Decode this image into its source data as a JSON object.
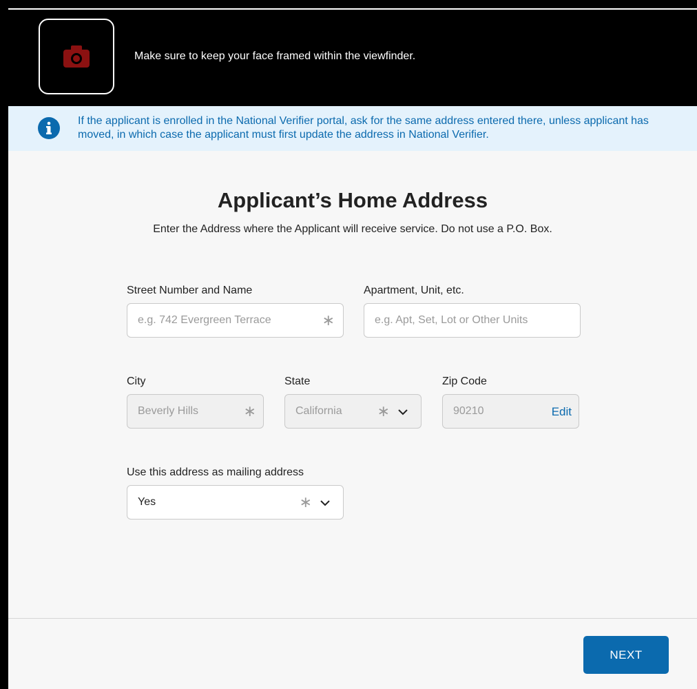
{
  "camera": {
    "message": "Make sure to keep your face framed within the viewfinder.",
    "icon": "camera-icon",
    "icon_color": "#8b1111"
  },
  "banner": {
    "icon": "info-icon",
    "text": "If the applicant is enrolled in the National Verifier portal, ask for the same address entered there, unless applicant has moved, in which case the applicant must first update the address in National Verifier."
  },
  "form": {
    "title": "Applicant’s Home Address",
    "subtitle": "Enter the Address where the Applicant will receive service. Do not use a P.O. Box.",
    "street": {
      "label": "Street Number and Name",
      "placeholder": "e.g. 742 Evergreen Terrace",
      "required_mark": "∗"
    },
    "apartment": {
      "label": "Apartment, Unit, etc.",
      "placeholder": "e.g. Apt, Set, Lot or Other Units"
    },
    "city": {
      "label": "City",
      "value": "Beverly Hills",
      "required_mark": "∗"
    },
    "state": {
      "label": "State",
      "value": "California",
      "required_mark": "∗"
    },
    "zip": {
      "label": "Zip Code",
      "value": "90210",
      "edit_label": "Edit"
    },
    "mailing": {
      "label": "Use this address as mailing address",
      "value": "Yes",
      "required_mark": "∗"
    }
  },
  "footer": {
    "next_label": "NEXT"
  },
  "colors": {
    "accent": "#0b6aae",
    "banner_bg": "#e4f2fc"
  }
}
